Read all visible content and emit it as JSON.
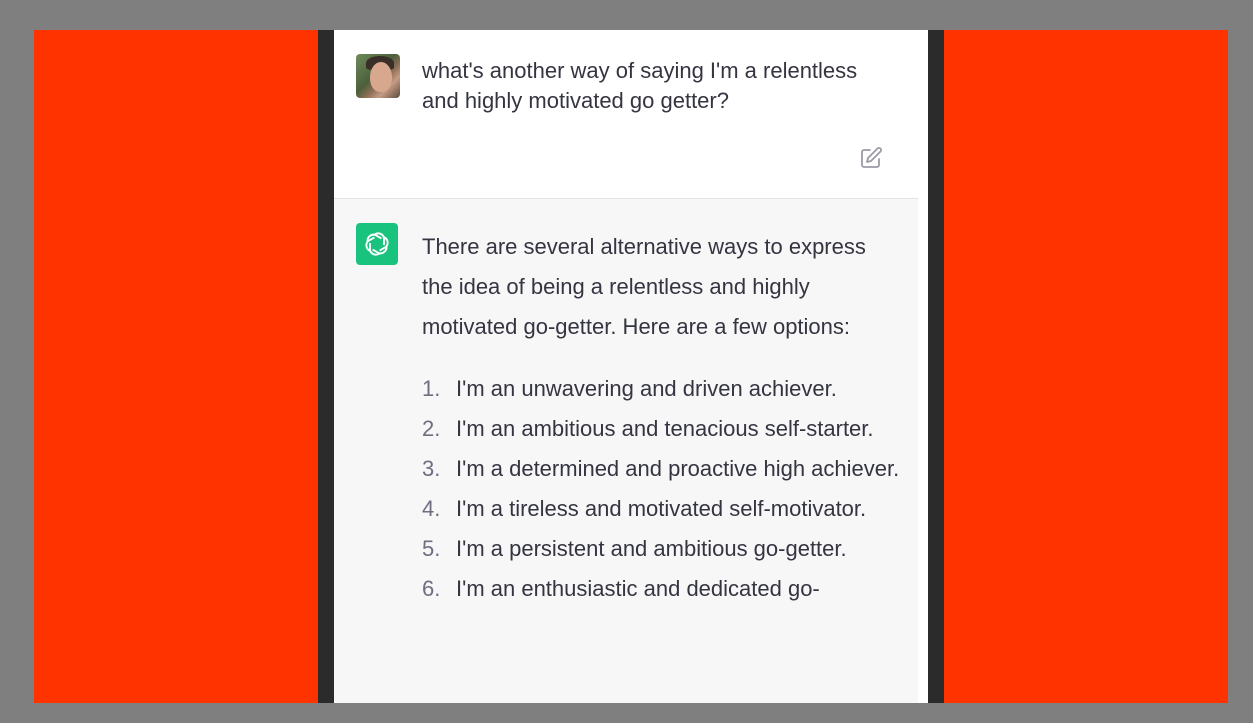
{
  "user_message": {
    "text": "what's another way of saying I'm a relentless and highly motivated go getter?"
  },
  "assistant_message": {
    "intro": "There are several alternative ways to express the idea of being a relentless and highly motivated go-getter. Here are a few options:",
    "options": [
      {
        "num": "1.",
        "text": "I'm an unwavering and driven achiever."
      },
      {
        "num": "2.",
        "text": "I'm an ambitious and tenacious self-starter."
      },
      {
        "num": "3.",
        "text": "I'm a determined and proactive high achiever."
      },
      {
        "num": "4.",
        "text": "I'm a tireless and motivated self-motivator."
      },
      {
        "num": "5.",
        "text": "I'm a persistent and ambitious go-getter."
      },
      {
        "num": "6.",
        "text": "I'm an enthusiastic and dedicated go-"
      }
    ]
  },
  "icons": {
    "edit": "edit-icon",
    "assistant_logo": "openai-logo-icon",
    "user_avatar": "avatar"
  },
  "colors": {
    "frame": "#7f7f7f",
    "side_panels": "#ff3300",
    "dark_strip": "#2a2b2a",
    "assistant_bg": "#f7f7f8",
    "logo_bg": "#19c37d",
    "text": "#343541"
  }
}
